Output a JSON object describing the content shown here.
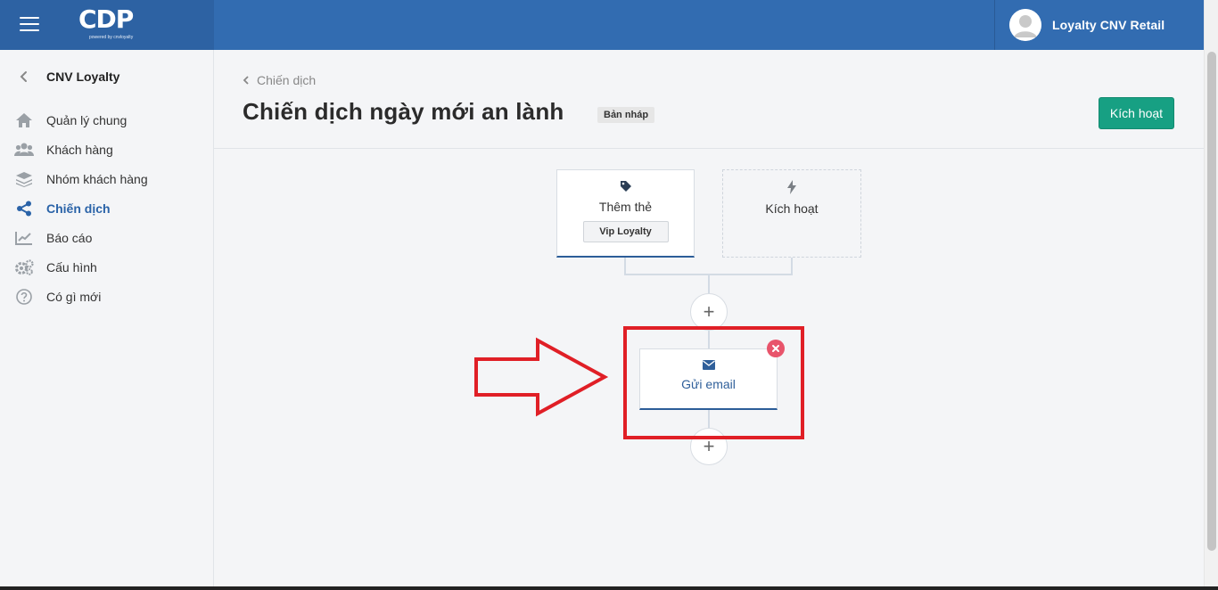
{
  "app": {
    "logo_text": "CDP",
    "logo_sub": "powered by cnvloyalty",
    "user_name": "Loyalty CNV Retail"
  },
  "sidebar": {
    "header": "CNV Loyalty",
    "items": [
      {
        "label": "Quản lý chung",
        "icon": "home-icon"
      },
      {
        "label": "Khách hàng",
        "icon": "users-icon"
      },
      {
        "label": "Nhóm khách hàng",
        "icon": "layers-icon"
      },
      {
        "label": "Chiến dịch",
        "icon": "share-icon",
        "active": true
      },
      {
        "label": "Báo cáo",
        "icon": "chart-icon"
      },
      {
        "label": "Cấu hình",
        "icon": "gears-icon"
      },
      {
        "label": "Có gì mới",
        "icon": "help-icon"
      }
    ]
  },
  "main": {
    "breadcrumb": "Chiến dịch",
    "title": "Chiến dịch ngày mới an lành",
    "status_badge": "Bản nháp",
    "activate_label": "Kích hoạt"
  },
  "flow": {
    "tag_node": {
      "label": "Thêm thẻ",
      "tag_value": "Vip Loyalty",
      "icon": "tag-icon"
    },
    "trigger_node": {
      "label": "Kích hoạt",
      "icon": "bolt-icon"
    },
    "email_node": {
      "label": "Gửi email",
      "icon": "envelope-icon"
    },
    "add_symbol": "+"
  },
  "colors": {
    "header_bg": "#326cb1",
    "accent_green": "#17a083",
    "active_nav": "#2a63a8",
    "highlight_red": "#e01f26"
  }
}
